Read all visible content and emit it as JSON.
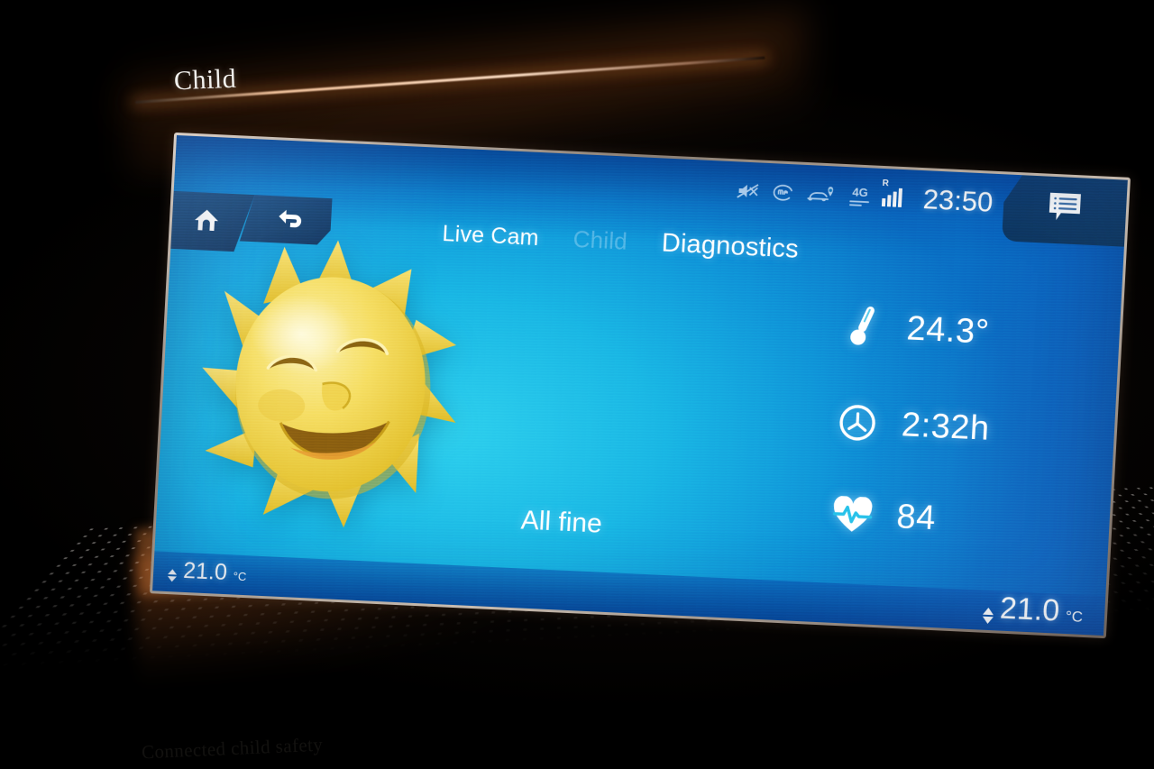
{
  "scene": {
    "title": "Child",
    "footer_caption": "Connected child safety"
  },
  "statusbar": {
    "icons": [
      {
        "name": "mute-icon",
        "label": "muted"
      },
      {
        "name": "me-logo-icon",
        "label": "me"
      },
      {
        "name": "car-location-icon",
        "label": "car location"
      },
      {
        "name": "network-4g-icon",
        "label": "4G"
      },
      {
        "name": "signal-bars-icon",
        "label": "signal"
      }
    ],
    "network_label": "4G",
    "roaming_label": "R",
    "clock": "23:50"
  },
  "messages": {
    "icon": "message-list-icon"
  },
  "nav": {
    "home_label": "Home",
    "back_label": "Back"
  },
  "tabs": [
    {
      "label": "Live Cam",
      "state": "inactive"
    },
    {
      "label": "Child",
      "state": "dimmed"
    },
    {
      "label": "Diagnostics",
      "state": "active"
    }
  ],
  "main": {
    "avatar": "smiling-sun-icon",
    "status_text": "All fine",
    "metrics": [
      {
        "icon": "thermometer-icon",
        "label": "temperature",
        "value": "24.3°"
      },
      {
        "icon": "clock-icon",
        "label": "duration",
        "value": "2:32h"
      },
      {
        "icon": "heart-rate-icon",
        "label": "heart rate",
        "value": "84"
      }
    ]
  },
  "climate": {
    "left": {
      "value": "21.0",
      "unit": "°C"
    },
    "right": {
      "value": "21.0",
      "unit": "°C"
    }
  },
  "colors": {
    "screen_cyan": "#1fc3ec",
    "screen_blue": "#0a6fc4",
    "panel_dark_blue": "#123f72",
    "accent_white": "#ffffff",
    "sun_yellow": "#f2d23c",
    "ambient_amber": "#ff9a42"
  }
}
